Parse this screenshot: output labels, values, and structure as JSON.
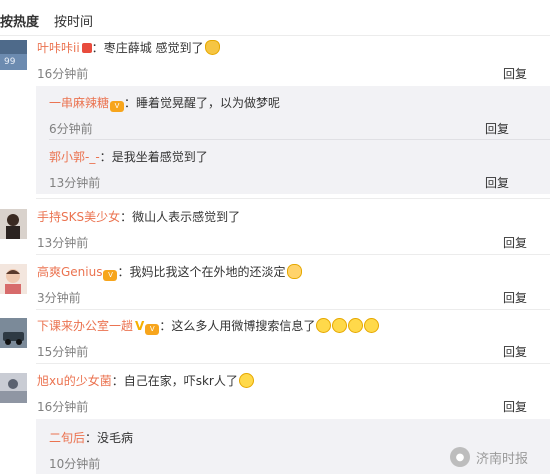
{
  "sort": {
    "active": "按热度",
    "other": "按时间"
  },
  "reply_label": "回复",
  "comments": [
    {
      "user": "叶咔咔ii",
      "colon": "：",
      "text": "枣庄薛城 感觉到了",
      "time": "16分钟前",
      "replies": [
        {
          "user": "一串麻辣糖",
          "colon": "：",
          "text": "睡着觉晃醒了，以为做梦呢",
          "time": "6分钟前"
        },
        {
          "user": "郭小郭-_-",
          "colon": "：",
          "text": "是我坐着感觉到了",
          "time": "13分钟前"
        }
      ]
    },
    {
      "user": "手持SKS美少女",
      "colon": "：",
      "text": "微山人表示感觉到了",
      "time": "13分钟前"
    },
    {
      "user": "高爽Genius",
      "colon": "：",
      "text": "我妈比我这个在外地的还淡定",
      "time": "3分钟前"
    },
    {
      "user": "下课来办公室一趟",
      "colon": "：",
      "text": "这么多人用微博搜索信息了",
      "time": "15分钟前"
    },
    {
      "user": "旭xu的少女菌",
      "colon": "：",
      "text": "自己在家，吓skr人了",
      "time": "16分钟前",
      "replies": [
        {
          "user": "二旬后",
          "colon": "：",
          "text": "没毛病",
          "time": "10分钟前"
        }
      ]
    }
  ],
  "watermark": "济南时报",
  "colors": {
    "username": "#eb7350",
    "sub_bg": "#f2f2f5",
    "time": "#808080"
  }
}
